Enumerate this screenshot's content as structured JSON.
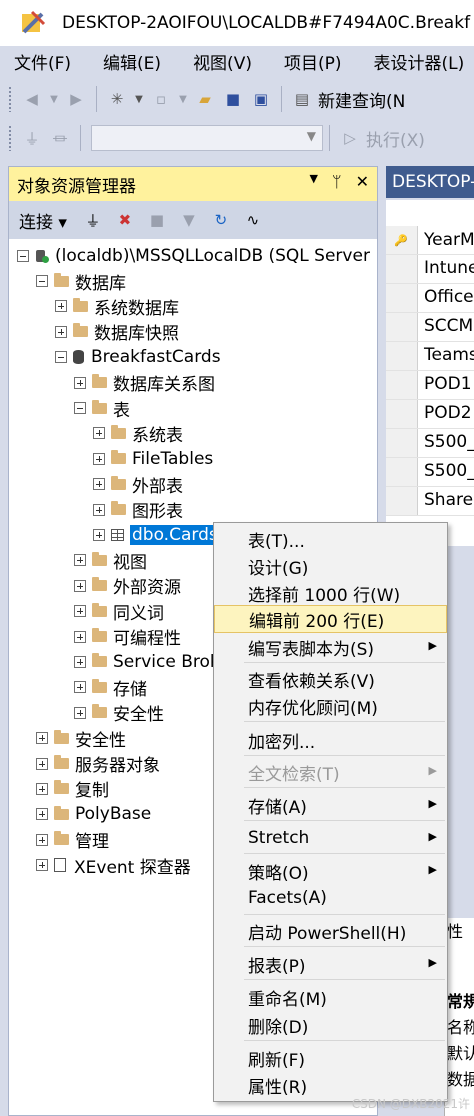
{
  "window": {
    "title": "DESKTOP-2AOIFOU\\LOCALDB#F7494A0C.Breakf"
  },
  "menu": [
    "文件(F)",
    "编辑(E)",
    "视图(V)",
    "项目(P)",
    "表设计器(L)"
  ],
  "toolbar": {
    "new_query": "新建查询(N",
    "execute": "执行(X)"
  },
  "object_explorer": {
    "title": "对象资源管理器",
    "connect": "连接",
    "tree": {
      "server": "(localdb)\\MSSQLLocalDB (SQL Server 1",
      "databases": "数据库",
      "system_databases": "系统数据库",
      "database_snapshots": "数据库快照",
      "breakfastcards": "BreakfastCards",
      "db_diagrams": "数据库关系图",
      "tables": "表",
      "system_tables": "系统表",
      "filetables": "FileTables",
      "external_tables": "外部表",
      "graph_tables": "图形表",
      "dbo_cards": "dbo.Cards",
      "views": "视图",
      "external_resources": "外部资源",
      "synonyms": "同义词",
      "programmability": "可编程性",
      "service_broker": "Service Brok",
      "storage": "存储",
      "db_security": "安全性",
      "security": "安全性",
      "server_objects": "服务器对象",
      "replication": "复制",
      "polybase": "PolyBase",
      "management": "管理",
      "xevent": "XEvent 探查器"
    }
  },
  "document": {
    "tab_title": "DESKTOP-",
    "columns": [
      "YearM",
      "Intune",
      "Office",
      "SCCM",
      "Teams",
      "POD1",
      "POD2",
      "S500_",
      "S500_",
      "Share"
    ],
    "props_partial": [
      "性",
      "常規",
      "名称",
      "默认",
      "数据"
    ]
  },
  "context_menu": {
    "table": "表(T)...",
    "design": "设计(G)",
    "select_top": "选择前 1000 行(W)",
    "edit_top": "编辑前 200 行(E)",
    "script_as": "编写表脚本为(S)",
    "view_dependencies": "查看依赖关系(V)",
    "memory_advisor": "内存优化顾问(M)",
    "encrypt": "加密列...",
    "fulltext": "全文检索(T)",
    "storage": "存储(A)",
    "stretch": "Stretch",
    "policies": "策略(O)",
    "facets": "Facets(A)",
    "powershell": "启动 PowerShell(H)",
    "reports": "报表(P)",
    "rename": "重命名(M)",
    "delete": "删除(D)",
    "refresh": "刷新(F)",
    "properties": "属性(R)"
  },
  "watermark": "CSDN @DXB2021许"
}
